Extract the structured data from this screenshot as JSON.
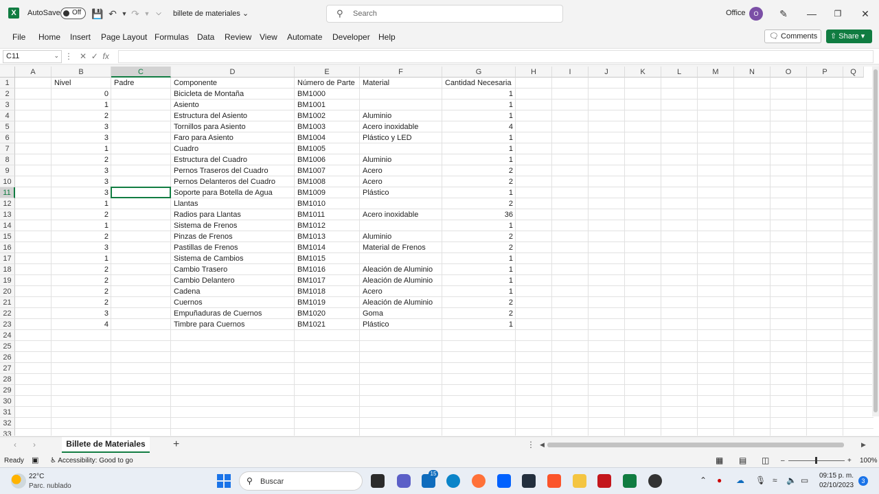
{
  "titlebar": {
    "autosave_label": "AutoSave",
    "autosave_state": "Off",
    "document_title": "billete de materiales",
    "search_placeholder": "Search",
    "office_label": "Office",
    "avatar_initial": "O"
  },
  "menu": {
    "items": [
      "File",
      "Home",
      "Insert",
      "Page Layout",
      "Formulas",
      "Data",
      "Review",
      "View",
      "Automate",
      "Developer",
      "Help"
    ],
    "comments_label": "Comments",
    "share_label": "Share"
  },
  "formula_bar": {
    "name_box": "C11",
    "fx_label": "fx",
    "formula": ""
  },
  "grid": {
    "columns": [
      "A",
      "B",
      "C",
      "D",
      "E",
      "F",
      "G",
      "H",
      "I",
      "J",
      "K",
      "L",
      "M",
      "N",
      "O",
      "P",
      "Q"
    ],
    "row_numbers": [
      "1",
      "2",
      "3",
      "4",
      "5",
      "6",
      "7",
      "8",
      "9",
      "10",
      "11",
      "12",
      "13",
      "14",
      "15",
      "16",
      "17",
      "18",
      "19",
      "20",
      "21",
      "22",
      "23",
      "24",
      "25",
      "26",
      "27",
      "28",
      "29",
      "30",
      "31",
      "32",
      "33"
    ],
    "selected_column": "C",
    "selected_row": "11",
    "headers": {
      "nivel": "Nivel",
      "padre": "Padre",
      "componente": "Componente",
      "numero": "Número de Parte",
      "material": "Material",
      "cantidad": "Cantidad Necesaria"
    },
    "rows": [
      {
        "nivel": "0",
        "componente": "Bicicleta de Montaña",
        "numero": "BM1000",
        "material": "",
        "cantidad": "1"
      },
      {
        "nivel": "1",
        "componente": "Asiento",
        "numero": "BM1001",
        "material": "",
        "cantidad": "1"
      },
      {
        "nivel": "2",
        "componente": "Estructura del Asiento",
        "numero": "BM1002",
        "material": "Aluminio",
        "cantidad": "1"
      },
      {
        "nivel": "3",
        "componente": "Tornillos para Asiento",
        "numero": "BM1003",
        "material": "Acero inoxidable",
        "cantidad": "4"
      },
      {
        "nivel": "3",
        "componente": "Faro para Asiento",
        "numero": "BM1004",
        "material": "Plástico y LED",
        "cantidad": "1"
      },
      {
        "nivel": "1",
        "componente": "Cuadro",
        "numero": "BM1005",
        "material": "",
        "cantidad": "1"
      },
      {
        "nivel": "2",
        "componente": "Estructura del Cuadro",
        "numero": "BM1006",
        "material": "Aluminio",
        "cantidad": "1"
      },
      {
        "nivel": "3",
        "componente": "Pernos Traseros del Cuadro",
        "numero": "BM1007",
        "material": "Acero",
        "cantidad": "2"
      },
      {
        "nivel": "3",
        "componente": "Pernos Delanteros del Cuadro",
        "numero": "BM1008",
        "material": "Acero",
        "cantidad": "2"
      },
      {
        "nivel": "3",
        "componente": "Soporte para Botella de Agua",
        "numero": "BM1009",
        "material": "Plástico",
        "cantidad": "1"
      },
      {
        "nivel": "1",
        "componente": "Llantas",
        "numero": "BM1010",
        "material": "",
        "cantidad": "2"
      },
      {
        "nivel": "2",
        "componente": "Radios para Llantas",
        "numero": "BM1011",
        "material": "Acero inoxidable",
        "cantidad": "36"
      },
      {
        "nivel": "1",
        "componente": "Sistema de Frenos",
        "numero": "BM1012",
        "material": "",
        "cantidad": "1"
      },
      {
        "nivel": "2",
        "componente": "Pinzas de Frenos",
        "numero": "BM1013",
        "material": "Aluminio",
        "cantidad": "2"
      },
      {
        "nivel": "3",
        "componente": "Pastillas de Frenos",
        "numero": "BM1014",
        "material": "Material de Frenos",
        "cantidad": "2"
      },
      {
        "nivel": "1",
        "componente": "Sistema de Cambios",
        "numero": "BM1015",
        "material": "",
        "cantidad": "1"
      },
      {
        "nivel": "2",
        "componente": "Cambio Trasero",
        "numero": "BM1016",
        "material": "Aleación de Aluminio",
        "cantidad": "1"
      },
      {
        "nivel": "2",
        "componente": "Cambio Delantero",
        "numero": "BM1017",
        "material": "Aleación de Aluminio",
        "cantidad": "1"
      },
      {
        "nivel": "2",
        "componente": "Cadena",
        "numero": "BM1018",
        "material": "Acero",
        "cantidad": "1"
      },
      {
        "nivel": "2",
        "componente": "Cuernos",
        "numero": "BM1019",
        "material": "Aleación de Aluminio",
        "cantidad": "2"
      },
      {
        "nivel": "3",
        "componente": "Empuñaduras de Cuernos",
        "numero": "BM1020",
        "material": "Goma",
        "cantidad": "2"
      },
      {
        "nivel": "4",
        "componente": "Timbre para Cuernos",
        "numero": "BM1021",
        "material": "Plástico",
        "cantidad": "1"
      }
    ]
  },
  "sheets": {
    "active": "Billete de Materiales",
    "add_label": "+"
  },
  "statusbar": {
    "ready": "Ready",
    "accessibility": "Accessibility: Good to go",
    "zoom": "100%"
  },
  "taskbar": {
    "temperature": "22°C",
    "weather": "Parc. nublado",
    "search_placeholder": "Buscar",
    "mail_badge": "15",
    "time": "09:15 p. m.",
    "date": "02/10/2023",
    "notifications": "3"
  },
  "colors": {
    "excel_green": "#107c41",
    "gridline": "#e1e1e1"
  }
}
